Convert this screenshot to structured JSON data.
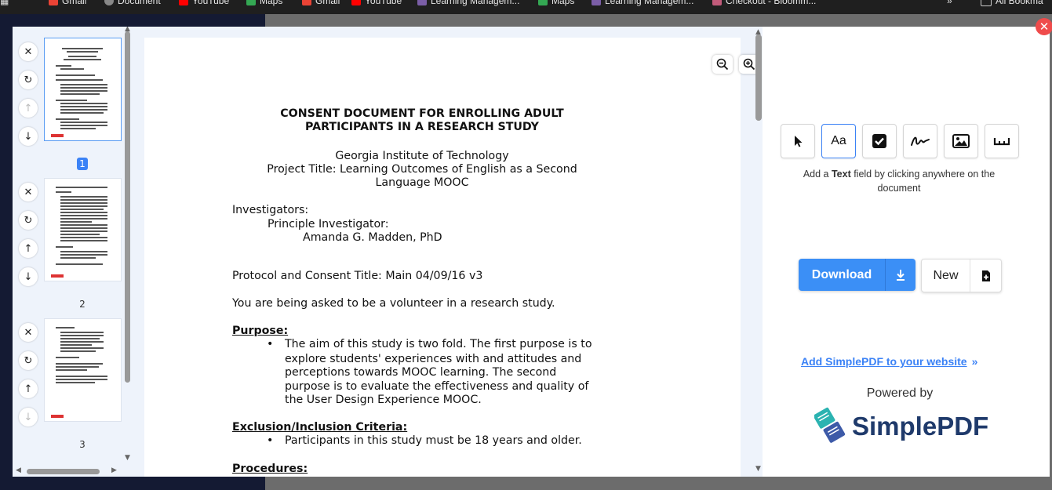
{
  "browser": {
    "bookmarks": [
      {
        "label": "Gmail",
        "color": "#ea4335"
      },
      {
        "label": "Document",
        "color": "#888888"
      },
      {
        "label": "YouTube",
        "color": "#ff0000"
      },
      {
        "label": "Maps",
        "color": "#34a853"
      },
      {
        "label": "Gmail",
        "color": "#ea4335"
      },
      {
        "label": "YouTube",
        "color": "#ff0000"
      },
      {
        "label": "Learning Managem...",
        "color": "#7b5ea7"
      },
      {
        "label": "Maps",
        "color": "#34a853"
      },
      {
        "label": "Learning Managem...",
        "color": "#7b5ea7"
      },
      {
        "label": "Checkout - Bloomm...",
        "color": "#c25b7a"
      },
      {
        "label": "All Bookma",
        "color": "#888888"
      }
    ]
  },
  "modal": {
    "close_label": "✕"
  },
  "thumbnails": {
    "pages": [
      {
        "number": "1",
        "active": true
      },
      {
        "number": "2",
        "active": false
      },
      {
        "number": "3",
        "active": false
      }
    ],
    "controls": {
      "delete_icon": "close-icon",
      "rotate_icon": "rotate-icon",
      "move_up_icon": "arrow-up-icon",
      "move_down_icon": "arrow-down-icon"
    }
  },
  "document": {
    "title_line1": "CONSENT DOCUMENT FOR ENROLLING ADULT",
    "title_line2": "PARTICIPANTS IN A RESEARCH STUDY",
    "institution": "Georgia Institute of Technology",
    "project_line1": "Project Title: Learning Outcomes of English as a Second",
    "project_line2": "Language MOOC",
    "investigators_label": "Investigators:",
    "pi_label": "Principle Investigator:",
    "pi_name": "Amanda G. Madden, PhD",
    "protocol": "Protocol and Consent Title: Main 04/09/16 v3",
    "volunteer": "You are being asked to be a volunteer in a research study.",
    "purpose_heading": "Purpose:",
    "purpose_lines": [
      "The aim of this study is two fold. The first purpose is to",
      "explore students' experiences with and attitudes and",
      "perceptions towards MOOC learning. The second",
      "purpose is to evaluate the effectiveness and quality of",
      "the User Design Experience MOOC."
    ],
    "criteria_heading": "Exclusion/Inclusion Criteria:",
    "criteria_lines": [
      "Participants in this study must be 18 years and older."
    ],
    "procedures_heading": "Procedures:",
    "bullet": "•",
    "zoom_out_icon": "zoom-out-icon",
    "zoom_in_icon": "zoom-in-icon"
  },
  "tools": {
    "items": [
      {
        "name": "select",
        "icon": "cursor-icon"
      },
      {
        "name": "text",
        "icon": "text-aa-icon",
        "label": "Aa",
        "active": true
      },
      {
        "name": "checkbox",
        "icon": "checkbox-icon"
      },
      {
        "name": "signature",
        "icon": "signature-icon"
      },
      {
        "name": "image",
        "icon": "image-icon"
      },
      {
        "name": "whiteout",
        "icon": "ruler-icon"
      }
    ],
    "hint_prefix": "Add a ",
    "hint_bold": "Text",
    "hint_suffix": " field by clicking anywhere on the document"
  },
  "actions": {
    "download_label": "Download",
    "new_label": "New",
    "add_site_link": "Add SimplePDF to your website",
    "add_site_chevron": "»",
    "powered_by": "Powered by",
    "brand_name": "SimplePDF",
    "accent": "#3b8ff6",
    "brand_color": "#1f3a6b"
  }
}
